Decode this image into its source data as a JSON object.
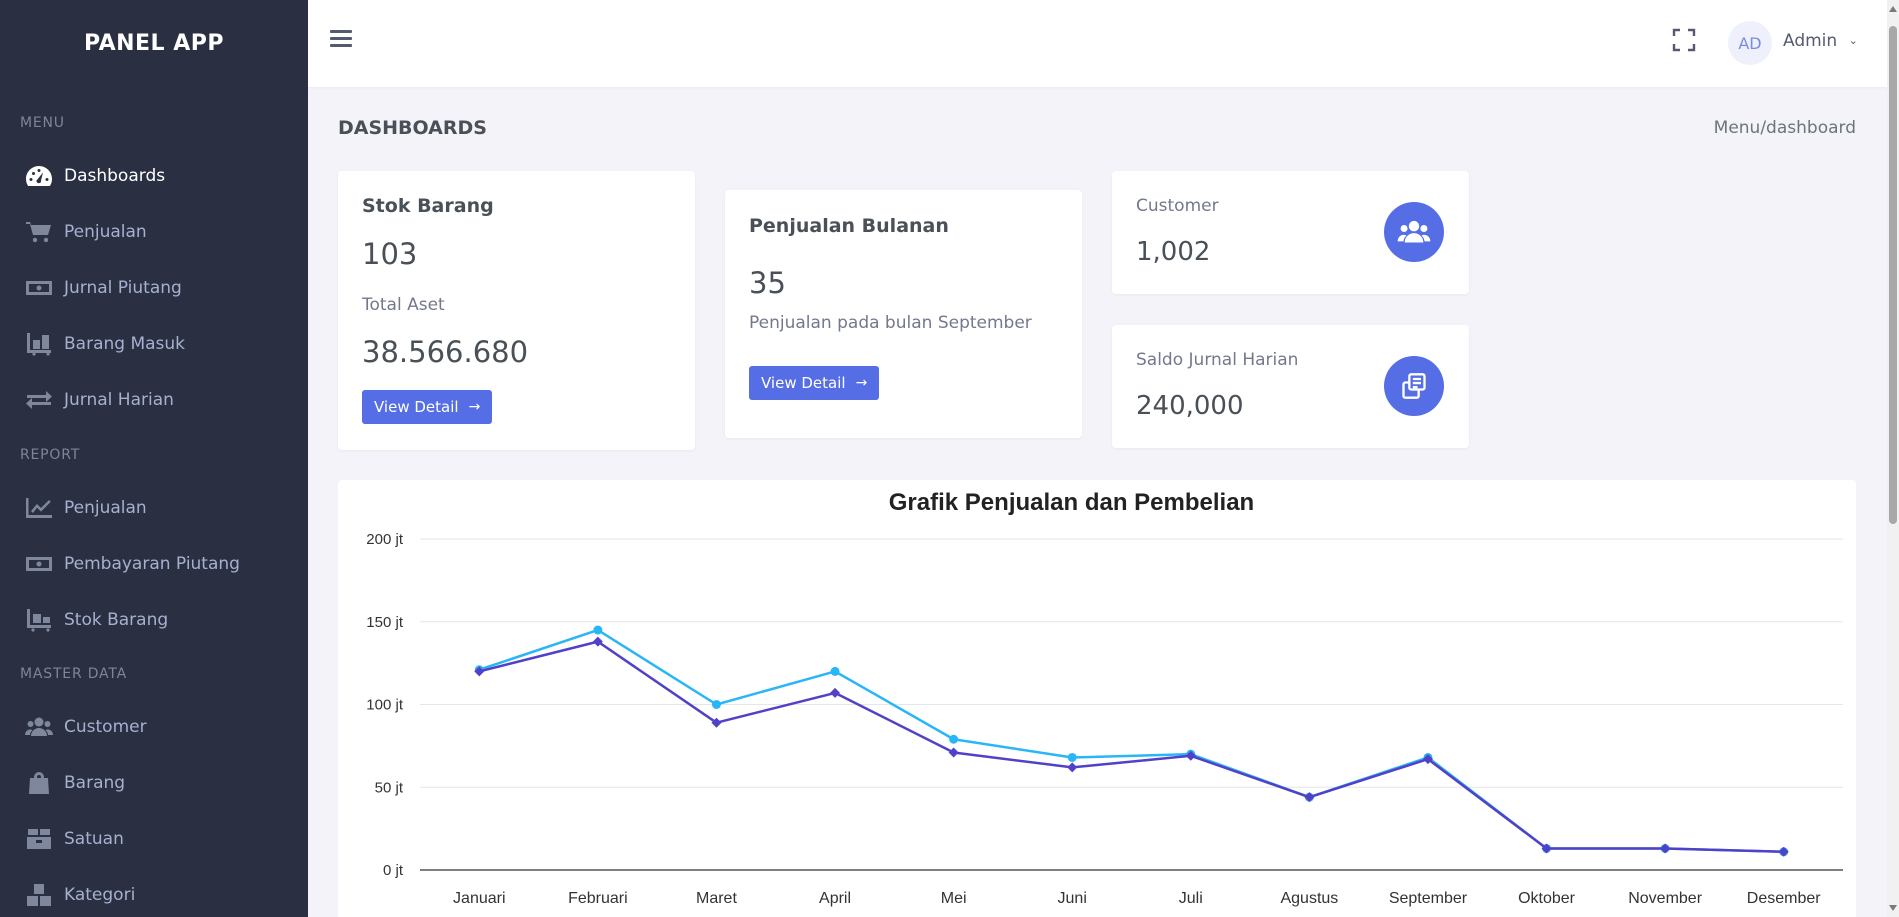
{
  "brand": "PANEL APP",
  "sidebar": {
    "sections": [
      {
        "title": "MENU",
        "items": [
          {
            "label": "Dashboards",
            "icon": "dashboard-gauge-icon",
            "active": true
          },
          {
            "label": "Penjualan",
            "icon": "cart-icon"
          },
          {
            "label": "Jurnal Piutang",
            "icon": "money-bill-icon"
          },
          {
            "label": "Barang Masuk",
            "icon": "luggage-cart-icon"
          },
          {
            "label": "Jurnal Harian",
            "icon": "exchange-arrows-icon"
          }
        ]
      },
      {
        "title": "REPORT",
        "items": [
          {
            "label": "Penjualan",
            "icon": "line-chart-icon"
          },
          {
            "label": "Pembayaran Piutang",
            "icon": "money-bill-icon"
          },
          {
            "label": "Stok Barang",
            "icon": "pallet-icon"
          }
        ]
      },
      {
        "title": "MASTER DATA",
        "items": [
          {
            "label": "Customer",
            "icon": "users-icon"
          },
          {
            "label": "Barang",
            "icon": "shopping-bag-icon"
          },
          {
            "label": "Satuan",
            "icon": "box-icon"
          },
          {
            "label": "Kategori",
            "icon": "boxes-icon"
          }
        ]
      }
    ]
  },
  "topbar": {
    "avatar_initials": "AD",
    "user_name": "Admin"
  },
  "page": {
    "title": "DASHBOARDS",
    "breadcrumb": "Menu/dashboard"
  },
  "cards": {
    "stok": {
      "title": "Stok Barang",
      "value": "103",
      "sub_label": "Total Aset",
      "sub_value": "38.566.680",
      "button": "View Detail"
    },
    "penjualan": {
      "title": "Penjualan Bulanan",
      "value": "35",
      "caption": "Penjualan pada bulan September",
      "button": "View Detail"
    },
    "customer": {
      "label": "Customer",
      "value": "1,002",
      "icon": "users-icon"
    },
    "saldo": {
      "label": "Saldo Jurnal Harian",
      "value": "240,000",
      "icon": "copy-docs-icon"
    }
  },
  "colors": {
    "accent": "#556ee6",
    "sidebar_bg": "#2a3042",
    "series_light": "#29b6f6",
    "series_dark": "#5141c8"
  },
  "chart_data": {
    "type": "line",
    "title": "Grafik Penjualan dan Pembelian",
    "categories": [
      "Januari",
      "Februari",
      "Maret",
      "April",
      "Mei",
      "Juni",
      "Juli",
      "Agustus",
      "September",
      "Oktober",
      "November",
      "Desember"
    ],
    "y_ticks": [
      "0 jt",
      "50 jt",
      "100 jt",
      "150 jt",
      "200 jt"
    ],
    "ylim": [
      0,
      200
    ],
    "grid": true,
    "series": [
      {
        "values": [
          121,
          145,
          100,
          120,
          79,
          68,
          70,
          44,
          68,
          13,
          13,
          11
        ],
        "color": "#29b6f6",
        "marker": "circle"
      },
      {
        "values": [
          120,
          138,
          89,
          107,
          71,
          62,
          69,
          44,
          67,
          13,
          13,
          11
        ],
        "color": "#5141c8",
        "marker": "diamond"
      }
    ]
  }
}
